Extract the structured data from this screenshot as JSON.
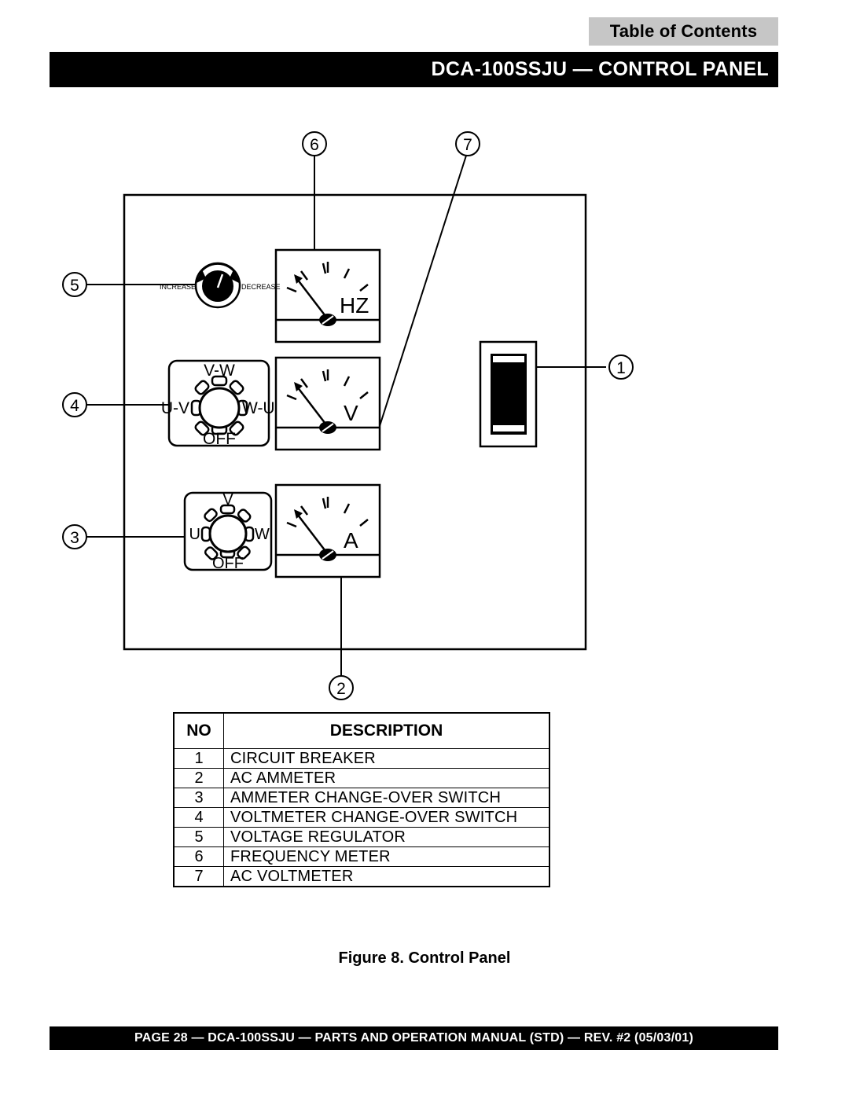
{
  "toc": {
    "label": "Table of Contents"
  },
  "header": {
    "title": "DCA-100SSJU — CONTROL PANEL"
  },
  "figure": {
    "caption": "Figure 8. Control Panel",
    "callouts": [
      {
        "id": "1",
        "number": "1"
      },
      {
        "id": "2",
        "number": "2"
      },
      {
        "id": "3",
        "number": "3"
      },
      {
        "id": "4",
        "number": "4"
      },
      {
        "id": "5",
        "number": "5"
      },
      {
        "id": "6",
        "number": "6"
      },
      {
        "id": "7",
        "number": "7"
      }
    ],
    "meters": {
      "frequency_meter_label": "HZ",
      "voltmeter_label": "V",
      "ammeter_label": "A"
    },
    "voltage_regulator": {
      "increase_label": "INCREASE",
      "decrease_label": "DECREASE"
    },
    "voltmeter_switch": {
      "top_label": "V-W",
      "left_label": "U-V",
      "right_label": "W-U",
      "bottom_label": "OFF"
    },
    "ammeter_switch": {
      "top_label": "V",
      "left_label": "U",
      "right_label": "W",
      "bottom_label": "OFF"
    }
  },
  "table": {
    "headers": {
      "no": "NO",
      "description": "DESCRIPTION"
    },
    "rows": [
      {
        "no": "1",
        "description": "CIRCUIT BREAKER"
      },
      {
        "no": "2",
        "description": "AC AMMETER"
      },
      {
        "no": "3",
        "description": "AMMETER CHANGE-OVER SWITCH"
      },
      {
        "no": "4",
        "description": "VOLTMETER CHANGE-OVER SWITCH"
      },
      {
        "no": "5",
        "description": "VOLTAGE REGULATOR"
      },
      {
        "no": "6",
        "description": "FREQUENCY METER"
      },
      {
        "no": "7",
        "description": "AC VOLTMETER"
      }
    ]
  },
  "footer": {
    "text": "PAGE 28 — DCA-100SSJU — PARTS AND OPERATION  MANUAL (STD) — REV. #2  (05/03/01)"
  },
  "colors": {
    "toc_background": "#c6c6c6",
    "bar_background": "#000000",
    "bar_text": "#ffffff",
    "line": "#000000",
    "page_background": "#ffffff"
  }
}
